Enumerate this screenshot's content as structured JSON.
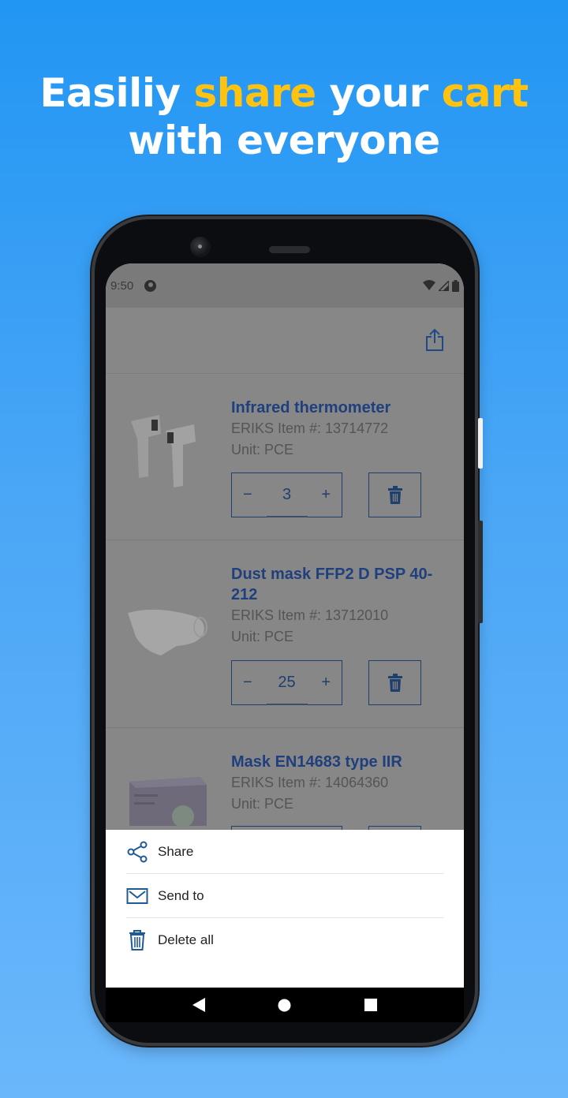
{
  "headline": {
    "line1_part1": "Easiliy ",
    "line1_highlight1": "share",
    "line1_part2": " your ",
    "line1_highlight2": "cart",
    "line2": "with everyone",
    "highlight_color": "#ffc20e"
  },
  "statusbar": {
    "time": "9:50",
    "icons": [
      "app-notification-icon",
      "wifi-icon",
      "signal-icon",
      "battery-icon"
    ]
  },
  "appbar": {
    "share_icon": "share-upload-icon"
  },
  "cart": {
    "items": [
      {
        "title": "Infrared thermometer",
        "item_number": "ERIKS Item #: 13714772",
        "unit": "Unit: PCE",
        "quantity": "3",
        "image": "infrared-thermometer-image"
      },
      {
        "title": "Dust mask FFP2 D PSP 40-212",
        "item_number": "ERIKS Item #: 13712010",
        "unit": "Unit: PCE",
        "quantity": "25",
        "image": "dust-mask-image"
      },
      {
        "title": "Mask EN14683 type IIR",
        "item_number": "ERIKS Item #: 14064360",
        "unit": "Unit: PCE",
        "quantity": "",
        "image": "mask-box-image"
      }
    ],
    "minus": "−",
    "plus": "+"
  },
  "sheet": {
    "items": [
      {
        "label": "Share",
        "icon": "share-icon"
      },
      {
        "label": "Send to",
        "icon": "mail-icon"
      },
      {
        "label": "Delete all",
        "icon": "trash-icon"
      }
    ]
  },
  "colors": {
    "brand_blue": "#1f3f7d",
    "bg_top": "#2196f3",
    "bg_bottom": "#6ab7fb"
  }
}
